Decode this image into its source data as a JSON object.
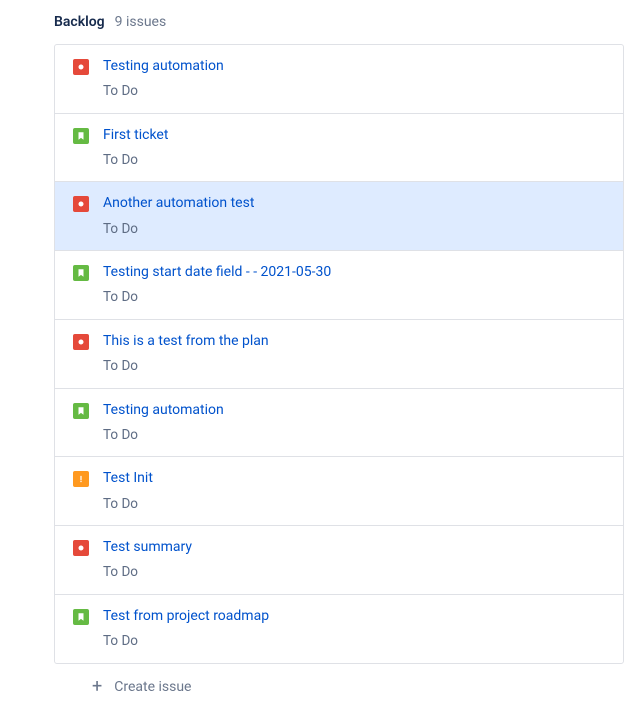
{
  "header": {
    "title": "Backlog",
    "count": "9 issues"
  },
  "issues": [
    {
      "type": "bug",
      "title": "Testing automation",
      "status": "To Do",
      "selected": false
    },
    {
      "type": "story",
      "title": "First ticket",
      "status": "To Do",
      "selected": false
    },
    {
      "type": "bug",
      "title": "Another automation test",
      "status": "To Do",
      "selected": true
    },
    {
      "type": "story",
      "title": "Testing start date field - - 2021-05-30",
      "status": "To Do",
      "selected": false
    },
    {
      "type": "bug",
      "title": "This is a test from the plan",
      "status": "To Do",
      "selected": false
    },
    {
      "type": "story",
      "title": "Testing automation",
      "status": "To Do",
      "selected": false
    },
    {
      "type": "task",
      "title": "Test Init",
      "status": "To Do",
      "selected": false
    },
    {
      "type": "bug",
      "title": "Test summary",
      "status": "To Do",
      "selected": false
    },
    {
      "type": "story",
      "title": "Test from project roadmap",
      "status": "To Do",
      "selected": false
    }
  ],
  "create": {
    "label": "Create issue"
  }
}
